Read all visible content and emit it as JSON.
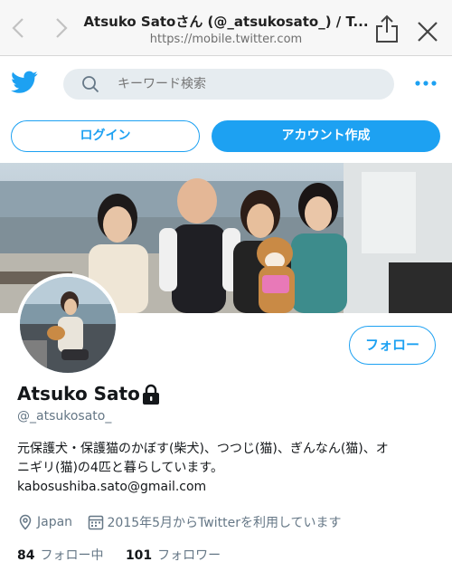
{
  "browser": {
    "page_title": "Atsuko Satoさん (@_atsukosato_) / T...",
    "url": "https://mobile.twitter.com"
  },
  "header": {
    "search_placeholder": "キーワード検索"
  },
  "auth": {
    "login_label": "ログイン",
    "signup_label": "アカウント作成"
  },
  "profile": {
    "follow_label": "フォロー",
    "display_name": "Atsuko Sato",
    "handle": "@_atsukosato_",
    "bio_line1": "元保護犬・保護猫のかぼす(柴犬)、つつじ(猫)、ぎんなん(猫)、オ",
    "bio_line2": "ニギリ(猫)の4匹と暮らしています。",
    "email": "kabosushiba.sato@gmail.com",
    "location": "Japan",
    "joined": "2015年5月からTwitterを利用しています",
    "following_count": "84",
    "following_label": "フォロー中",
    "followers_count": "101",
    "followers_label": "フォロワー"
  },
  "colors": {
    "accent": "#1da1f2",
    "secondary_text": "#657786"
  }
}
